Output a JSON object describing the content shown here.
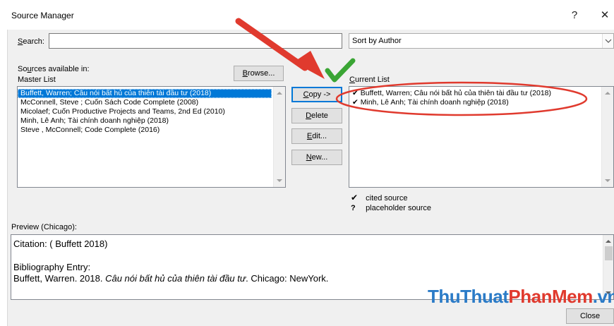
{
  "window": {
    "title": "Source Manager",
    "help_label": "?",
    "close_label": "✕"
  },
  "search": {
    "label_prefix": "",
    "label_hotkey": "S",
    "label_rest": "earch:",
    "value": ""
  },
  "sort": {
    "selected": "Sort by Author"
  },
  "master": {
    "sources_label_pre": "So",
    "sources_label_hotkey": "u",
    "sources_label_rest": "rces available in:",
    "list_label": "Master List",
    "browse_hotkey": "B",
    "browse_rest": "rowse...",
    "items": [
      "Buffett, Warren; Câu nói bất hủ của thiên tài đầu tư (2018)",
      "McConnell, Steve ; Cuốn Sách Code Complete (2008)",
      "Micolaef; Cuốn Productive Projects and Teams, 2nd Ed (2010)",
      "Minh, Lê  Anh; Tài chính doanh nghiệp  (2018)",
      "Steve , McConnell; Code Complete (2016)"
    ]
  },
  "actions": {
    "copy_hotkey": "C",
    "copy_rest": "opy ->",
    "delete_hotkey": "D",
    "delete_rest": "elete",
    "edit_hotkey": "E",
    "edit_rest": "dit...",
    "new_hotkey": "N",
    "new_rest": "ew..."
  },
  "current": {
    "label_hotkey": "C",
    "label_rest": "urrent List",
    "items": [
      {
        "mark": "✔",
        "text": "Buffett, Warren; Câu nói bất hủ của thiên tài đầu tư (2018)"
      },
      {
        "mark": "✔",
        "text": "Minh, Lê  Anh; Tài chính doanh nghiệp  (2018)"
      }
    ]
  },
  "legend": {
    "cited_mark": "✔",
    "cited_label": "cited source",
    "placeholder_mark": "?",
    "placeholder_label": "placeholder source"
  },
  "preview": {
    "label": "Preview (Chicago):",
    "citation": "Citation:  ( Buffett 2018)",
    "bib_heading": "Bibliography Entry:",
    "bib_author": "Buffett, Warren. 2018. ",
    "bib_title": "Câu nói bất hủ của thiên tài đầu tư",
    "bib_rest": ". Chicago: NewYork."
  },
  "footer": {
    "close_label": "Close"
  },
  "watermark": {
    "part1": "ThuThuat",
    "part2": "PhanMem",
    "part3": ".vn"
  },
  "colors": {
    "annotation_red": "#e03a2e",
    "check_green": "#3aa534",
    "selection_blue": "#0078d7"
  }
}
